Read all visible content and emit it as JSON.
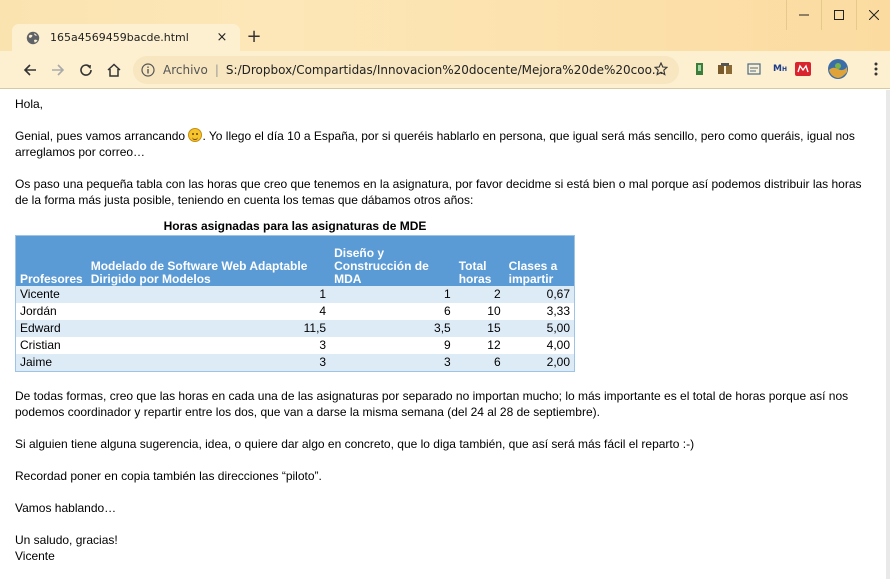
{
  "browser": {
    "tab_title": "165a4569459bacde.html",
    "tab_close": "×",
    "new_tab": "+",
    "scheme_label": "Archivo",
    "url": "S:/Dropbox/Compartidas/Innovacion%20docente/Mejora%20de%20coo...",
    "accent": "#fbe3b0"
  },
  "email": {
    "greeting": "Hola,",
    "p1_before": "Genial, pues vamos arrancando ",
    "p1_after": ". Yo llego el día 10 a España, por si queréis hablarlo en persona, que igual será más sencillo, pero como queráis, igual nos arreglamos por correo…",
    "p2": "Os paso una pequeña tabla con las horas que creo que tenemos en la asignatura, por favor decidme si está bien o mal porque así podemos distribuir las horas de la forma más justa posible, teniendo en cuenta los temas que dábamos otros años:",
    "table_title": "Horas asignadas para las asignaturas de MDE",
    "table_headers": [
      "Profesores",
      "Modelado de Software Web Adaptable Dirigido por Modelos",
      "Diseño y Construcción de MDA",
      "Total horas",
      "Clases a impartir"
    ],
    "table_rows": [
      [
        "Vicente",
        "1",
        "1",
        "2",
        "0,67"
      ],
      [
        "Jordán",
        "4",
        "6",
        "10",
        "3,33"
      ],
      [
        "Edward",
        "11,5",
        "3,5",
        "15",
        "5,00"
      ],
      [
        "Cristian",
        "3",
        "9",
        "12",
        "4,00"
      ],
      [
        "Jaime",
        "3",
        "3",
        "6",
        "2,00"
      ]
    ],
    "p3": "De todas formas, creo que las horas en cada una de las asignaturas por separado no importan mucho; lo más importante es el total de horas porque así nos podemos coordinador y repartir entre los dos, que van a darse la misma semana (del 24 al 28 de septiembre).",
    "p4": "Si alguien tiene alguna sugerencia, idea, o quiere dar algo en concreto, que lo diga también, que así será más fácil el reparto :-)",
    "p5": "Recordad poner en copia también las direcciones “piloto”.",
    "p6": "Vamos hablando…",
    "closing": "Un saludo, gracias!",
    "signature": "Vicente"
  }
}
